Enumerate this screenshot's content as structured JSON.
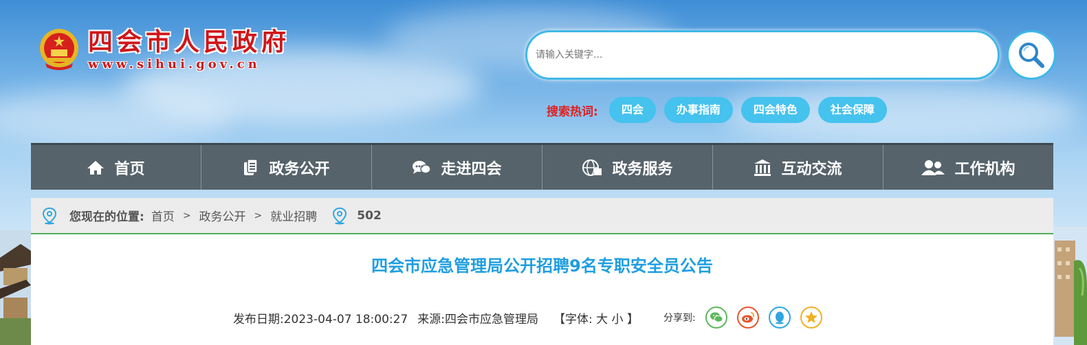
{
  "header": {
    "site_name": "四会市人民政府",
    "site_url": "www.sihui.gov.cn",
    "search_placeholder": "请输入关键字...",
    "hot_label": "搜索热词:",
    "hot_tags": [
      "四会",
      "办事指南",
      "四会特色",
      "社会保障"
    ]
  },
  "nav": {
    "items": [
      {
        "label": "首页",
        "icon": "home-icon"
      },
      {
        "label": "政务公开",
        "icon": "document-icon"
      },
      {
        "label": "走进四会",
        "icon": "chat-icon"
      },
      {
        "label": "政务服务",
        "icon": "globe-icon"
      },
      {
        "label": "互动交流",
        "icon": "institution-icon"
      },
      {
        "label": "工作机构",
        "icon": "people-icon"
      }
    ]
  },
  "breadcrumb": {
    "label": "您现在的位置:",
    "items": [
      "首页",
      "政务公开",
      "就业招聘"
    ],
    "separator": ">",
    "views": "502"
  },
  "article": {
    "title": "四会市应急管理局公开招聘9名专职安全员公告",
    "date": "发布日期:2023-04-07 18:00:27",
    "source": "来源:四会市应急管理局",
    "font_size_label": "【字体: 大 小 】",
    "share_label": "分享到:"
  },
  "colors": {
    "brand_red": "#d0161a",
    "accent_blue": "#1f9ee0",
    "tag_blue": "#45c2ee",
    "nav_bg": "#56636b",
    "breadcrumb_border": "#4fae5a"
  }
}
